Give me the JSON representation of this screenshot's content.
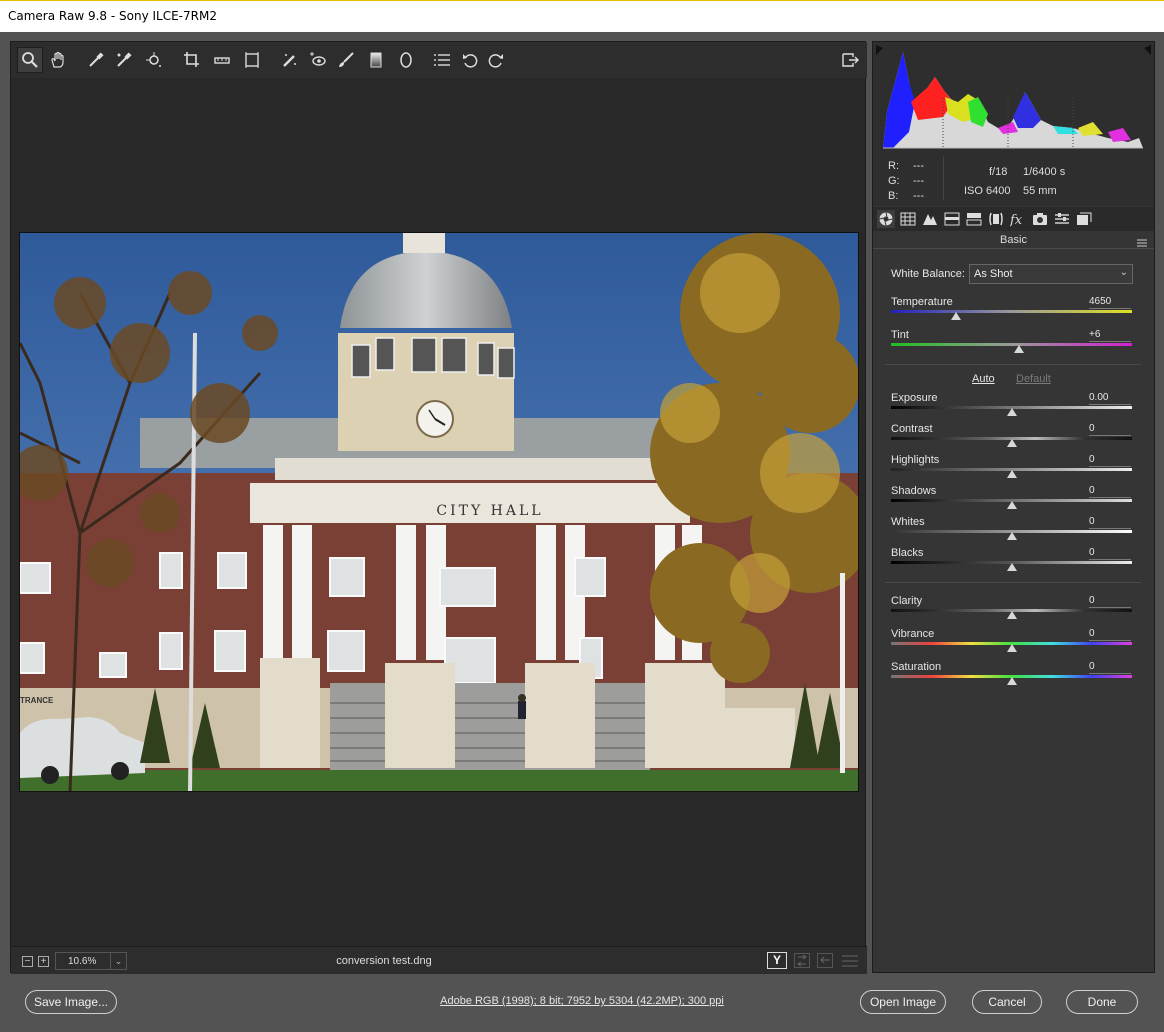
{
  "window": {
    "title": "Camera Raw 9.8  -  Sony ILCE-7RM2"
  },
  "toolbar": {
    "tools": [
      {
        "name": "zoom-tool",
        "icon": "magnifier-icon"
      },
      {
        "name": "hand-tool",
        "icon": "hand-icon"
      },
      {
        "name": "white-balance-tool",
        "icon": "eyedropper-icon"
      },
      {
        "name": "color-sampler-tool",
        "icon": "color-sampler-icon"
      },
      {
        "name": "targeted-adjustment-tool",
        "icon": "target-adjust-icon"
      },
      {
        "name": "crop-tool",
        "icon": "crop-icon"
      },
      {
        "name": "straighten-tool",
        "icon": "level-icon"
      },
      {
        "name": "transform-tool",
        "icon": "transform-icon"
      },
      {
        "name": "spot-removal-tool",
        "icon": "spot-heal-icon"
      },
      {
        "name": "red-eye-tool",
        "icon": "red-eye-icon"
      },
      {
        "name": "adjustment-brush-tool",
        "icon": "brush-icon"
      },
      {
        "name": "graduated-filter-tool",
        "icon": "gradient-icon"
      },
      {
        "name": "radial-filter-tool",
        "icon": "ellipse-icon"
      },
      {
        "name": "preferences-tool",
        "icon": "list-icon"
      },
      {
        "name": "rotate-ccw-tool",
        "icon": "rotate-left-icon"
      },
      {
        "name": "rotate-cw-tool",
        "icon": "rotate-right-icon"
      }
    ],
    "fullscreen_icon": "fullscreen-icon"
  },
  "statusbar": {
    "zoom_minus": "−",
    "zoom_plus": "+",
    "zoom_value": "10.6%",
    "zoom_arrow": "⌄",
    "filename": "conversion test.dng",
    "before_after_label": "Y"
  },
  "info": {
    "r_label": "R:",
    "r_value": "---",
    "g_label": "G:",
    "g_value": "---",
    "b_label": "B:",
    "b_value": "---",
    "aperture": "f/18",
    "shutter": "1/6400 s",
    "iso": "ISO 6400",
    "focal": "55 mm"
  },
  "panel": {
    "title": "Basic",
    "white_balance_label": "White Balance:",
    "white_balance_value": "As Shot",
    "auto_label": "Auto",
    "default_label": "Default",
    "sliders": [
      {
        "label": "Temperature",
        "value": "4650",
        "pos": 0.27
      },
      {
        "label": "Tint",
        "value": "+6",
        "pos": 0.53
      },
      {
        "label": "Exposure",
        "value": "0.00",
        "pos": 0.5
      },
      {
        "label": "Contrast",
        "value": "0",
        "pos": 0.5
      },
      {
        "label": "Highlights",
        "value": "0",
        "pos": 0.5
      },
      {
        "label": "Shadows",
        "value": "0",
        "pos": 0.5
      },
      {
        "label": "Whites",
        "value": "0",
        "pos": 0.5
      },
      {
        "label": "Blacks",
        "value": "0",
        "pos": 0.5
      },
      {
        "label": "Clarity",
        "value": "0",
        "pos": 0.5
      },
      {
        "label": "Vibrance",
        "value": "0",
        "pos": 0.5
      },
      {
        "label": "Saturation",
        "value": "0",
        "pos": 0.5
      }
    ]
  },
  "photo": {
    "sign_text": "CITY HALL",
    "entrance_text": "TRANCE"
  },
  "bottom": {
    "save_label": "Save Image...",
    "workflow_info": "Adobe RGB (1998); 8 bit; 7952 by 5304 (42.2MP); 300 ppi",
    "open_label": "Open Image",
    "cancel_label": "Cancel",
    "done_label": "Done"
  }
}
